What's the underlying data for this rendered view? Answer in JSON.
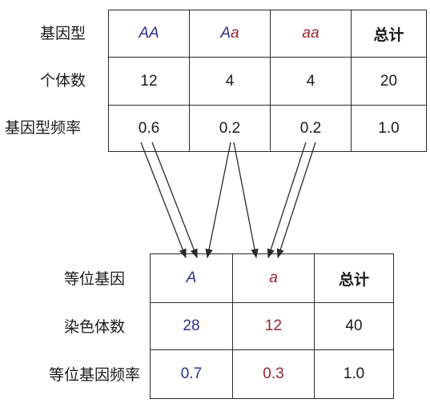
{
  "genotype_table": {
    "row_labels": [
      "基因型",
      "个体数",
      "基因型频率"
    ],
    "headers": [
      "AA",
      "Aa",
      "aa",
      "总计"
    ],
    "header_aa_A": "A",
    "header_aa_a": "a",
    "counts": [
      "12",
      "4",
      "4",
      "20"
    ],
    "freqs": [
      "0.6",
      "0.2",
      "0.2",
      "1.0"
    ]
  },
  "allele_table": {
    "row_labels": [
      "等位基因",
      "染色体数",
      "等位基因频率"
    ],
    "headers": [
      "A",
      "a",
      "总计"
    ],
    "counts": [
      "28",
      "12",
      "40"
    ],
    "freqs": [
      "0.7",
      "0.3",
      "1.0"
    ]
  },
  "colors": {
    "allele_A": "#2b2f8c",
    "allele_a": "#9a2330",
    "line": "#2a2a2a"
  }
}
